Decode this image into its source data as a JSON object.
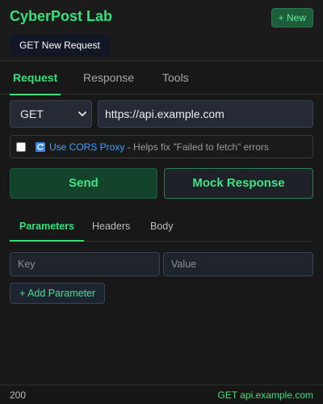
{
  "header": {
    "app_title": "CyberPost Lab",
    "new_label": "+ New",
    "request_tab_label": "GET New Request"
  },
  "tabs": [
    {
      "label": "Request",
      "active": true
    },
    {
      "label": "Response",
      "active": false
    },
    {
      "label": "Tools",
      "active": false
    }
  ],
  "request": {
    "method": "GET",
    "url": "https://api.example.com"
  },
  "cors": {
    "checked": false,
    "icon": "refresh-icon",
    "link_label": "Use CORS Proxy",
    "hint": " - Helps fix \"Failed to fetch\" errors"
  },
  "actions": {
    "send_label": "Send",
    "mock_label": "Mock Response"
  },
  "subtabs": [
    {
      "label": "Parameters",
      "active": true
    },
    {
      "label": "Headers",
      "active": false
    },
    {
      "label": "Body",
      "active": false
    }
  ],
  "params": {
    "key_placeholder": "Key",
    "value_placeholder": "Value",
    "add_label": "+ Add Parameter"
  },
  "footer": {
    "status": "200",
    "endpoint": "GET api.example.com"
  },
  "colors": {
    "accent": "#36e07a",
    "background": "#181818",
    "link": "#3ba3ff"
  }
}
